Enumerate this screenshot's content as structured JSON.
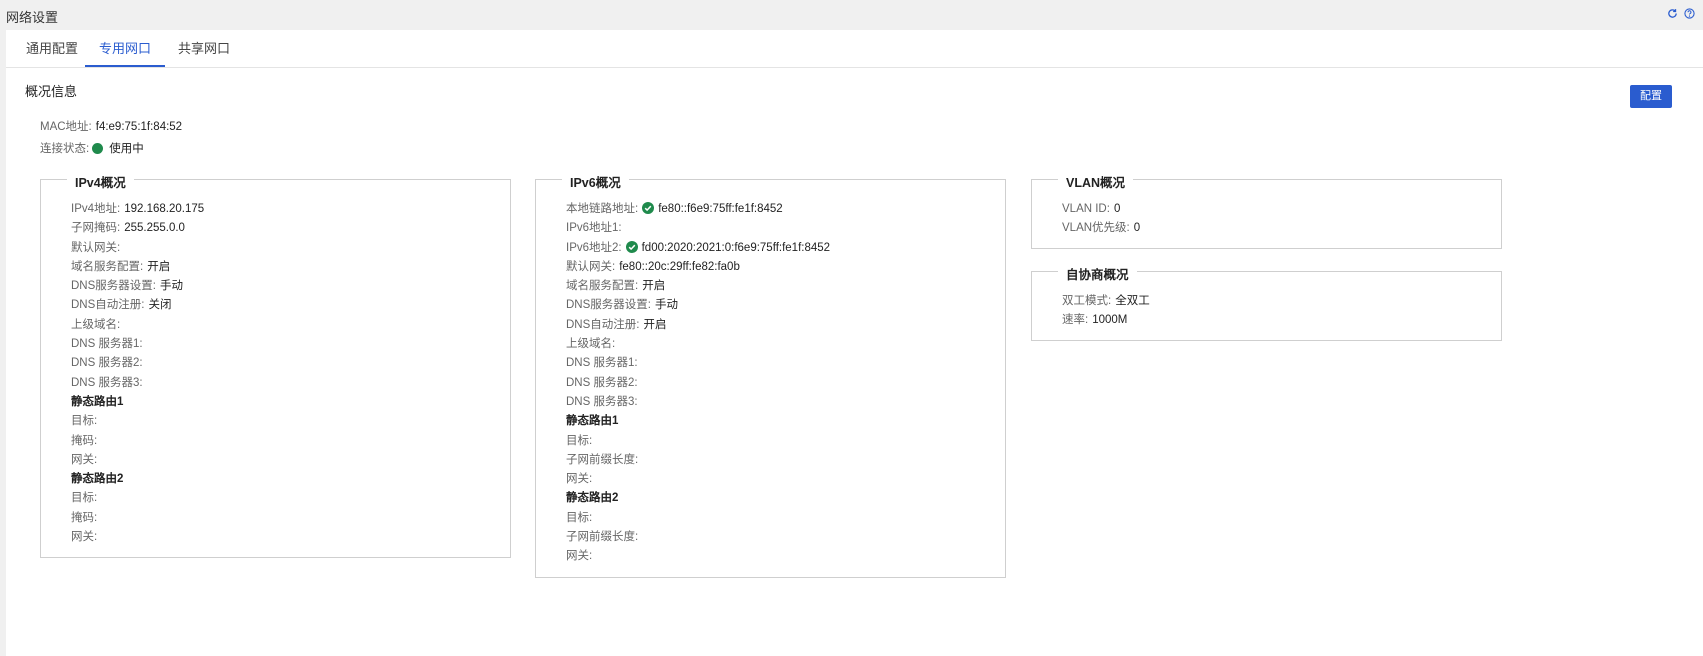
{
  "window": {
    "title": "网络设置"
  },
  "tabs": [
    {
      "label": "通用配置"
    },
    {
      "label": "专用网口"
    },
    {
      "label": "共享网口"
    }
  ],
  "overview": {
    "title": "概况信息",
    "config_label": "配置",
    "mac_label": "MAC地址:",
    "mac_value": "f4:e9:75:1f:84:52",
    "conn_label": "连接状态:",
    "conn_value": "使用中",
    "status_color": "#1f8a4c"
  },
  "ipv4": {
    "title": "IPv4概况",
    "rows": [
      {
        "k": "IPv4地址:",
        "v": "192.168.20.175"
      },
      {
        "k": "子网掩码:",
        "v": "255.255.0.0"
      },
      {
        "k": "默认网关:",
        "v": ""
      },
      {
        "k": "域名服务配置:",
        "v": "开启"
      },
      {
        "k": "DNS服务器设置:",
        "v": "手动"
      },
      {
        "k": "DNS自动注册:",
        "v": "关闭"
      },
      {
        "k": "上级域名:",
        "v": ""
      },
      {
        "k": "DNS 服务器1:",
        "v": ""
      },
      {
        "k": "DNS 服务器2:",
        "v": ""
      },
      {
        "k": "DNS 服务器3:",
        "v": ""
      },
      {
        "k": "静态路由1",
        "v": "",
        "section": true
      },
      {
        "k": "目标:",
        "v": ""
      },
      {
        "k": "掩码:",
        "v": ""
      },
      {
        "k": "网关:",
        "v": ""
      },
      {
        "k": "静态路由2",
        "v": "",
        "section": true
      },
      {
        "k": "目标:",
        "v": ""
      },
      {
        "k": "掩码:",
        "v": ""
      },
      {
        "k": "网关:",
        "v": ""
      }
    ]
  },
  "ipv6": {
    "title": "IPv6概况",
    "rows": [
      {
        "k": "本地链路地址:",
        "v": "fe80::f6e9:75ff:fe1f:8452",
        "check": true
      },
      {
        "k": "IPv6地址1:",
        "v": ""
      },
      {
        "k": "IPv6地址2:",
        "v": "fd00:2020:2021:0:f6e9:75ff:fe1f:8452",
        "check": true
      },
      {
        "k": "默认网关:",
        "v": "fe80::20c:29ff:fe82:fa0b"
      },
      {
        "k": "域名服务配置:",
        "v": "开启"
      },
      {
        "k": "DNS服务器设置:",
        "v": "手动"
      },
      {
        "k": "DNS自动注册:",
        "v": "开启"
      },
      {
        "k": "上级域名:",
        "v": ""
      },
      {
        "k": "DNS 服务器1:",
        "v": ""
      },
      {
        "k": "DNS 服务器2:",
        "v": ""
      },
      {
        "k": "DNS 服务器3:",
        "v": ""
      },
      {
        "k": "静态路由1",
        "v": "",
        "section": true
      },
      {
        "k": "目标:",
        "v": ""
      },
      {
        "k": "子网前缀长度:",
        "v": ""
      },
      {
        "k": "网关:",
        "v": ""
      },
      {
        "k": "静态路由2",
        "v": "",
        "section": true
      },
      {
        "k": "目标:",
        "v": ""
      },
      {
        "k": "子网前缀长度:",
        "v": ""
      },
      {
        "k": "网关:",
        "v": ""
      }
    ]
  },
  "vlan": {
    "title": "VLAN概况",
    "rows": [
      {
        "k": "VLAN ID:",
        "v": "0"
      },
      {
        "k": "VLAN优先级:",
        "v": "0"
      }
    ]
  },
  "autoneg": {
    "title": "自协商概况",
    "rows": [
      {
        "k": "双工模式:",
        "v": "全双工"
      },
      {
        "k": "速率:",
        "v": "1000M"
      }
    ]
  },
  "colors": {
    "accent": "#2a5ccf",
    "ok": "#1f8a4c"
  }
}
